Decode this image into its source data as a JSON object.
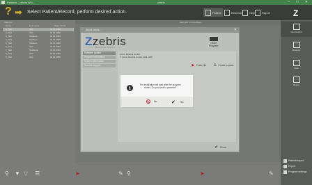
{
  "window": {
    "title": "Patients - zebris Win...",
    "center_title": "zebris",
    "controls": "– □ ✕"
  },
  "toolbar": {
    "question_glyph": "?",
    "arrow_glyph": "➡",
    "heading": "Select Patient/Record, perform desired action.",
    "buttons": [
      {
        "label": "Patient",
        "icon": "patient-icon"
      },
      {
        "label": "Research",
        "icon": "research-icon"
      },
      {
        "label": "Help",
        "icon": "help-icon"
      },
      {
        "label": "Report",
        "icon": "report-icon"
      }
    ],
    "logo_glyph": "Z"
  },
  "patients": {
    "column_headers": [
      "",
      "Name",
      "First name",
      "Date of birth"
    ],
    "rows": [
      {
        "name": "1_Test",
        "first": "Test",
        "dob": "01.01.1990"
      },
      {
        "name": "2_Test",
        "first": "Test",
        "dob": "01.01.1990"
      },
      {
        "name": "3_Test",
        "first": "Testdem",
        "dob": "01.01.1990"
      },
      {
        "name": "4_Test",
        "first": "Testdem",
        "dob": "01.01.1990"
      },
      {
        "name": "5_Test",
        "first": "Testdem",
        "dob": "01.01.1990"
      },
      {
        "name": "6_Test",
        "first": "Test",
        "dob": "01.01.1990"
      },
      {
        "name": "7_Test",
        "first": "Testdemo",
        "dob": "01.01.1990"
      },
      {
        "name": "8_Test",
        "first": "Test",
        "dob": "01.01.1990"
      },
      {
        "name": "9_Test",
        "first": "Test",
        "dob": "01.01.1990"
      }
    ]
  },
  "records": {
    "header": "Last year of recordings"
  },
  "right_panel": {
    "buttons": [
      {
        "label": "New Patient",
        "icon": "new-patient-icon"
      },
      {
        "label": "Measure",
        "icon": "measure-icon"
      },
      {
        "label": "View",
        "icon": "view-icon"
      },
      {
        "label": "Report",
        "icon": "report-icon"
      }
    ],
    "list": [
      {
        "label": "Patient/Import",
        "icon": "import-icon"
      },
      {
        "label": "Export",
        "icon": "export-icon"
      },
      {
        "label": "Program settings",
        "icon": "settings-icon"
      }
    ]
  },
  "about_dialog": {
    "title": "About zebris...",
    "close_x": "✕",
    "logo": "zebris",
    "logo_sub": "Medical GmbH",
    "exit_label": "Close\nProgram",
    "nav_items": [
      "Software update",
      "Program information",
      "System information",
      "Remote support"
    ],
    "license_lines": [
      "zebris Medical GmbH",
      "© zebris Medical GmbH 2019-2020"
    ],
    "order_label": "Order file",
    "create_label": "Create update",
    "close_label": "Close"
  },
  "message": {
    "text": "The installation will start after the program closes. Do you want to proceed?",
    "no_label": "No",
    "yes_label": "Yes"
  },
  "colors": {
    "titlebar": "#43824a",
    "accent_yellow": "#d2b22c",
    "danger_red": "#c0242b",
    "logo_blue": "#3d6aa6"
  }
}
